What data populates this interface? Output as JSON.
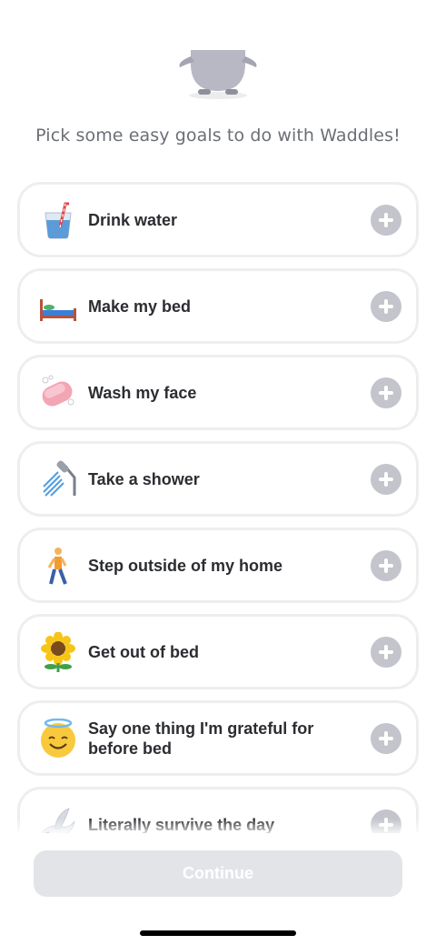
{
  "header": {
    "subtitle": "Pick some easy goals to do with Waddles!"
  },
  "goals": [
    {
      "label": "Drink water",
      "icon": "glass-of-water-icon"
    },
    {
      "label": "Make my bed",
      "icon": "bed-icon"
    },
    {
      "label": "Wash my face",
      "icon": "soap-icon"
    },
    {
      "label": "Take a shower",
      "icon": "shower-icon"
    },
    {
      "label": "Step outside of my home",
      "icon": "person-walking-icon"
    },
    {
      "label": "Get out of bed",
      "icon": "sunflower-icon"
    },
    {
      "label": "Say one thing I'm grateful for before bed",
      "icon": "smiling-face-with-halo-icon"
    },
    {
      "label": "Literally survive the day",
      "icon": "dove-icon"
    }
  ],
  "footer": {
    "continue_label": "Continue"
  },
  "colors": {
    "add_button": "#c3c4cc",
    "card_border": "#eeeef1",
    "continue_disabled": "#e3e4e8",
    "text": "#2b2d31"
  }
}
